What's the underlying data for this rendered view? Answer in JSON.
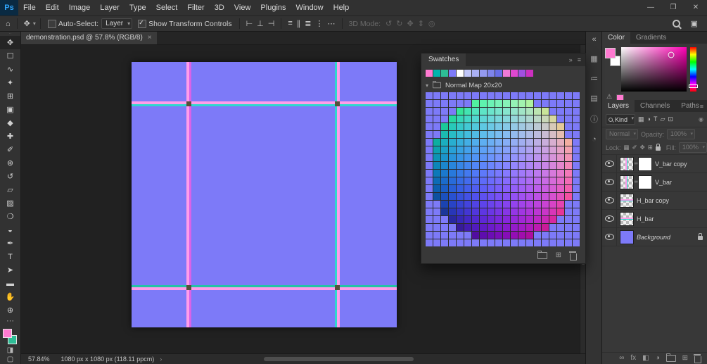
{
  "app": {
    "logo_text": "Ps",
    "window_controls": [
      {
        "name": "minimize-button",
        "glyph": "—"
      },
      {
        "name": "maximize-button",
        "glyph": "❐"
      },
      {
        "name": "close-button",
        "glyph": "✕"
      }
    ]
  },
  "menubar": {
    "items": [
      "File",
      "Edit",
      "Image",
      "Layer",
      "Type",
      "Select",
      "Filter",
      "3D",
      "View",
      "Plugins",
      "Window",
      "Help"
    ]
  },
  "options_bar": {
    "home_icon": "⌂",
    "tool_icon": "✥",
    "auto_select": {
      "label": "Auto-Select:",
      "value": "Layer",
      "checked": false
    },
    "show_transform": {
      "label": "Show Transform Controls",
      "checked": true
    },
    "align_icons": [
      {
        "name": "align-left-edges-icon",
        "glyph": "⊢"
      },
      {
        "name": "align-horizontal-centers-icon",
        "glyph": "⊥"
      },
      {
        "name": "align-right-edges-icon",
        "glyph": "⊣"
      }
    ],
    "distribute_icons": [
      {
        "name": "distribute-top-icon",
        "glyph": "≡"
      },
      {
        "name": "distribute-vertical-centers-icon",
        "glyph": "∥"
      },
      {
        "name": "distribute-bottom-icon",
        "glyph": "≣"
      },
      {
        "name": "distribute-spacing-icon",
        "glyph": "⋮"
      }
    ],
    "more_glyph": "⋯",
    "mode_3d": {
      "label": "3D Mode:",
      "icons": [
        {
          "name": "orbit-3d-icon",
          "glyph": "↺"
        },
        {
          "name": "roll-3d-icon",
          "glyph": "↻"
        },
        {
          "name": "pan-3d-icon",
          "glyph": "✥"
        },
        {
          "name": "slide-3d-icon",
          "glyph": "⇕"
        },
        {
          "name": "scale-3d-icon",
          "glyph": "◎"
        }
      ]
    },
    "workspace_icon": "▣"
  },
  "document_tab": {
    "title": "demonstration.psd @ 57.8% (RGB/8)",
    "close_glyph": "×"
  },
  "toolbar": {
    "grip_glyph": "∙∙",
    "tools": [
      {
        "name": "move-tool",
        "glyph": "✥"
      },
      {
        "name": "marquee-tool",
        "glyph": "☐"
      },
      {
        "name": "lasso-tool",
        "glyph": "∿"
      },
      {
        "name": "quick-selection-tool",
        "glyph": "✦"
      },
      {
        "name": "crop-tool",
        "glyph": "⊞"
      },
      {
        "name": "frame-tool",
        "glyph": "▣"
      },
      {
        "name": "eyedropper-tool",
        "glyph": "◆"
      },
      {
        "name": "healing-brush-tool",
        "glyph": "✚"
      },
      {
        "name": "brush-tool",
        "glyph": "✐"
      },
      {
        "name": "clone-stamp-tool",
        "glyph": "⊛"
      },
      {
        "name": "history-brush-tool",
        "glyph": "↺"
      },
      {
        "name": "eraser-tool",
        "glyph": "▱"
      },
      {
        "name": "gradient-tool",
        "glyph": "▨"
      },
      {
        "name": "blur-tool",
        "glyph": "❍"
      },
      {
        "name": "dodge-tool",
        "glyph": "◒"
      },
      {
        "name": "pen-tool",
        "glyph": "✒"
      },
      {
        "name": "type-tool",
        "glyph": "T"
      },
      {
        "name": "path-selection-tool",
        "glyph": "➤"
      },
      {
        "name": "rectangle-tool",
        "glyph": "▬"
      },
      {
        "name": "hand-tool",
        "glyph": "✋"
      },
      {
        "name": "zoom-tool",
        "glyph": "⊕"
      }
    ],
    "more_glyph": "⋯",
    "foreground_color": "#ff7ad1",
    "background_color": "#2ebd96",
    "quick_mask_glyph": "◨",
    "screen_mode_glyph": "▢"
  },
  "canvas": {
    "document": {
      "base_color": "#7d7af8",
      "crossing_color": "#55503a",
      "v_bars": [
        {
          "x_pct": 21.5,
          "stripes": [
            {
              "color": "#ff9de9",
              "w": 4
            },
            {
              "color": "#d863e8",
              "w": 3
            }
          ]
        },
        {
          "x_pct": 77.5,
          "stripes": [
            {
              "color": "#2ed8ce",
              "w": 3
            },
            {
              "color": "#ff9de9",
              "w": 4
            }
          ]
        }
      ],
      "h_bars": [
        {
          "y_pct": 15.6,
          "stripes": [
            {
              "color": "#ff9de9",
              "h": 4
            },
            {
              "color": "#2ed8ce",
              "h": 3
            }
          ]
        },
        {
          "y_pct": 84.8,
          "stripes": [
            {
              "color": "#24c2a8",
              "h": 3
            },
            {
              "color": "#ff9de9",
              "h": 4
            }
          ]
        }
      ]
    },
    "status": {
      "zoom": "57.84%",
      "info": "1080 px x 1080 px (118.11 ppcm)",
      "chevron": "›"
    }
  },
  "swatches_panel": {
    "title": "Swatches",
    "header_icons": [
      {
        "name": "double-arrow-icon",
        "glyph": "»"
      },
      {
        "name": "panel-menu-icon",
        "glyph": "≡"
      }
    ],
    "recent_swatches": [
      "#ff7ad1",
      "#00b4ac",
      "#2ebd96",
      "#7d7af8",
      "#ffffff",
      "#c0c6f8",
      "#aab0f4",
      "#949af0",
      "#7e84ec",
      "#686ee8",
      "#f07ad8",
      "#e048d0",
      "#a050e0",
      "#cc30c0"
    ],
    "group": {
      "caret": "▾",
      "label": "Normal Map 20x20"
    },
    "grid": {
      "type": "normal-map-sphere",
      "cols": 20,
      "rows": 20,
      "flat_color": "#7d7af8"
    },
    "footer_icons": [
      {
        "name": "new-swatch-group-icon",
        "type": "folder"
      },
      {
        "name": "new-swatch-icon",
        "glyph": "⊞"
      },
      {
        "name": "delete-swatch-icon",
        "type": "trash"
      }
    ]
  },
  "right_dock": {
    "strip_icons": [
      {
        "name": "collapse-dock-icon",
        "glyph": "«"
      },
      {
        "name": "histogram-panel-icon",
        "glyph": "▦"
      },
      {
        "name": "adjustments-panel-icon",
        "glyph": "≔"
      },
      {
        "name": "libraries-panel-icon",
        "glyph": "▤"
      },
      {
        "name": "info-panel-icon",
        "glyph": "ⓘ"
      },
      {
        "name": "history-panel-icon",
        "glyph": "◔"
      }
    ],
    "color_panel": {
      "tabs": [
        "Color",
        "Gradients"
      ],
      "foreground_color": "#ff7ad1",
      "background_color": "#ffffff",
      "hue_color": "#ff00b4",
      "warning_glyph": "⚠"
    },
    "layers_panel": {
      "tabs": [
        "Layers",
        "Channels",
        "Paths"
      ],
      "panel_menu_glyph": "≡",
      "filter": {
        "search_label": "Kind",
        "icons": [
          {
            "name": "filter-pixel-icon",
            "glyph": "▦"
          },
          {
            "name": "filter-adjustment-icon",
            "glyph": "◑"
          },
          {
            "name": "filter-type-icon",
            "glyph": "T"
          },
          {
            "name": "filter-shape-icon",
            "glyph": "▱"
          },
          {
            "name": "filter-smart-object-icon",
            "glyph": "⊡"
          }
        ],
        "switch_glyph": "◉"
      },
      "blend_mode": "Normal",
      "opacity_label": "Opacity:",
      "opacity_value": "100%",
      "lock_label": "Lock:",
      "lock_icons": [
        {
          "name": "lock-transparent-pixels-icon",
          "glyph": "▦"
        },
        {
          "name": "lock-image-pixels-icon",
          "glyph": "✐"
        },
        {
          "name": "lock-position-icon",
          "glyph": "✥"
        },
        {
          "name": "lock-artboard-icon",
          "glyph": "⊞"
        },
        {
          "name": "lock-all-icon",
          "type": "lock"
        }
      ],
      "fill_label": "Fill:",
      "fill_value": "100%",
      "layers": [
        {
          "name": "V_bar copy",
          "thumb": "checker-v",
          "mask": true
        },
        {
          "name": "V_bar",
          "thumb": "checker-v",
          "mask": true
        },
        {
          "name": "H_bar copy",
          "thumb": "checker-h",
          "mask": false
        },
        {
          "name": "H_bar",
          "thumb": "checker-h",
          "mask": false
        },
        {
          "name": "Background",
          "thumb": "color",
          "color": "#7d7af8",
          "locked": true,
          "italic": true
        }
      ],
      "thumb_line_colors": {
        "pink": "#ff9de9",
        "cyan": "#2ed8ce"
      },
      "footer_icons": [
        {
          "name": "link-layers-icon",
          "glyph": "∞"
        },
        {
          "name": "layer-effects-icon",
          "glyph": "fx"
        },
        {
          "name": "add-layer-mask-icon",
          "glyph": "◧"
        },
        {
          "name": "adjustment-layer-icon",
          "glyph": "◑"
        },
        {
          "name": "new-group-icon",
          "type": "folder"
        },
        {
          "name": "new-layer-icon",
          "glyph": "⊞"
        },
        {
          "name": "delete-layer-icon",
          "type": "trash"
        }
      ]
    }
  }
}
